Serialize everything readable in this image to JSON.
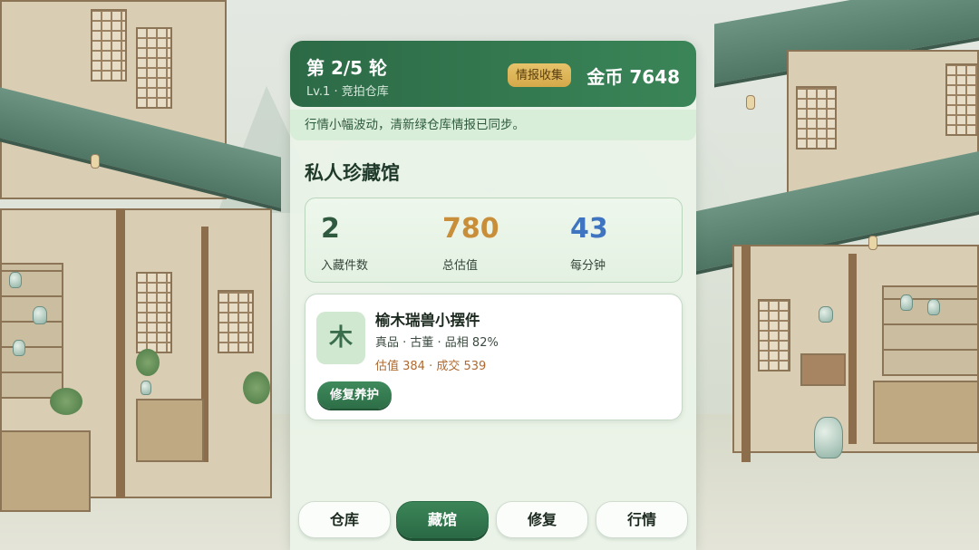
{
  "header": {
    "round": "第 2/5 轮",
    "subtitle": "Lv.1 · 竞拍仓库",
    "intel_button": "情报收集",
    "coins": "金币 7648"
  },
  "notice": "行情小幅波动，清新绿仓库情报已同步。",
  "hall_title": "私人珍藏馆",
  "stats": [
    {
      "value": "2",
      "label": "入藏件数",
      "color": "#2f5a3f"
    },
    {
      "value": "780",
      "label": "总估值",
      "color": "#c98e3a"
    },
    {
      "value": "43",
      "label": "每分钟",
      "color": "#3f74c0"
    }
  ],
  "item": {
    "icon_char": "木",
    "name": "榆木瑞兽小摆件",
    "tags": "真品 · 古董 · 品相 82%",
    "value": "估值 384 · 成交 539",
    "action": "修复养护"
  },
  "nav": {
    "items": [
      "仓库",
      "藏馆",
      "修复",
      "行情"
    ],
    "active": "藏馆"
  }
}
